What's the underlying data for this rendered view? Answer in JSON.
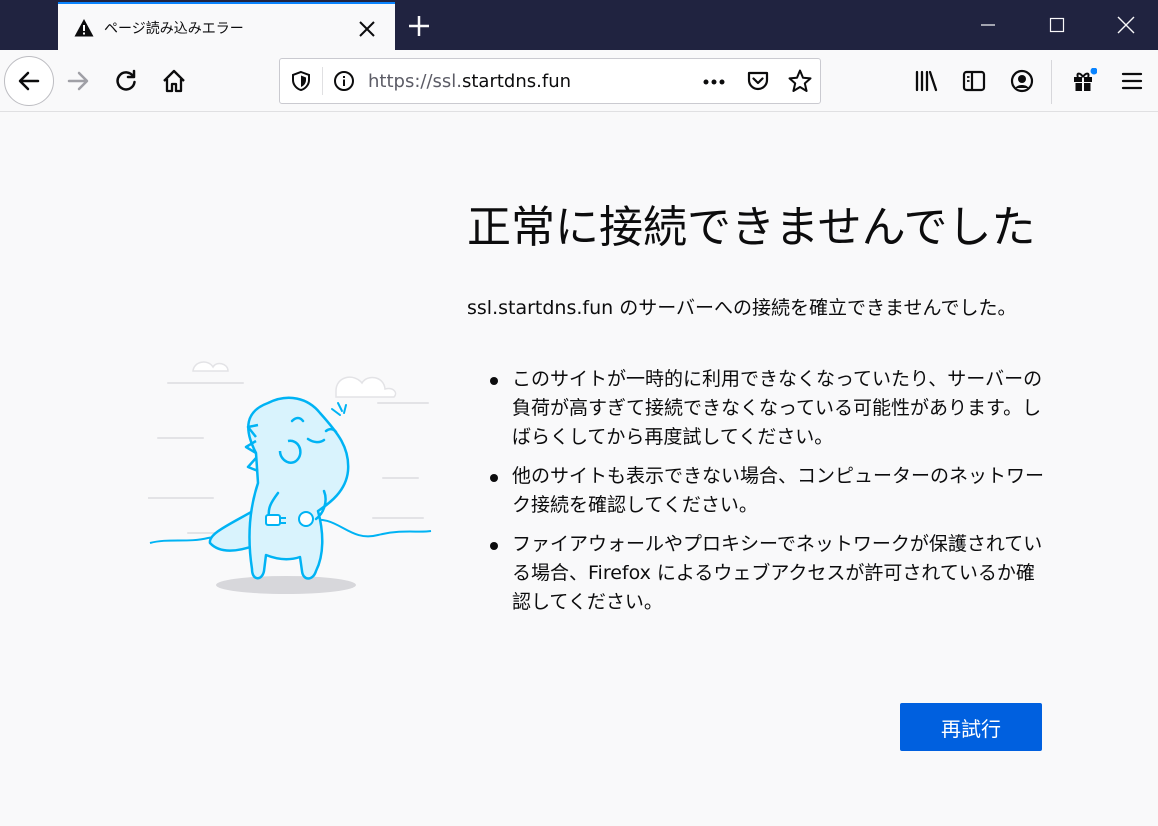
{
  "tab": {
    "title": "ページ読み込みエラー"
  },
  "urlbar": {
    "url_prefix": "https://ssl.",
    "url_domain": "startdns.fun"
  },
  "error": {
    "title": "正常に接続できませんでした",
    "description": "ssl.startdns.fun のサーバーへの接続を確立できませんでした。",
    "items": [
      "このサイトが一時的に利用できなくなっていたり、サーバーの負荷が高すぎて接続できなくなっている可能性があります。しばらくしてから再度試してください。",
      "他のサイトも表示できない場合、コンピューターのネットワーク接続を確認してください。",
      "ファイアウォールやプロキシーでネットワークが保護されている場合、Firefox によるウェブアクセスが許可されているか確認してください。"
    ],
    "retry_label": "再試行"
  },
  "colors": {
    "titlebar": "#202340",
    "tab_accent": "#0a84ff",
    "primary_button": "#0060df",
    "illustration_stroke": "#00b3f4"
  },
  "icons": [
    "warning-icon",
    "close-icon",
    "plus-icon",
    "minimize-icon",
    "maximize-icon",
    "back-icon",
    "forward-icon",
    "reload-icon",
    "home-icon",
    "shield-icon",
    "info-icon",
    "more-icon",
    "pocket-icon",
    "star-icon",
    "library-icon",
    "sidebar-icon",
    "account-icon",
    "gift-icon",
    "menu-icon"
  ]
}
